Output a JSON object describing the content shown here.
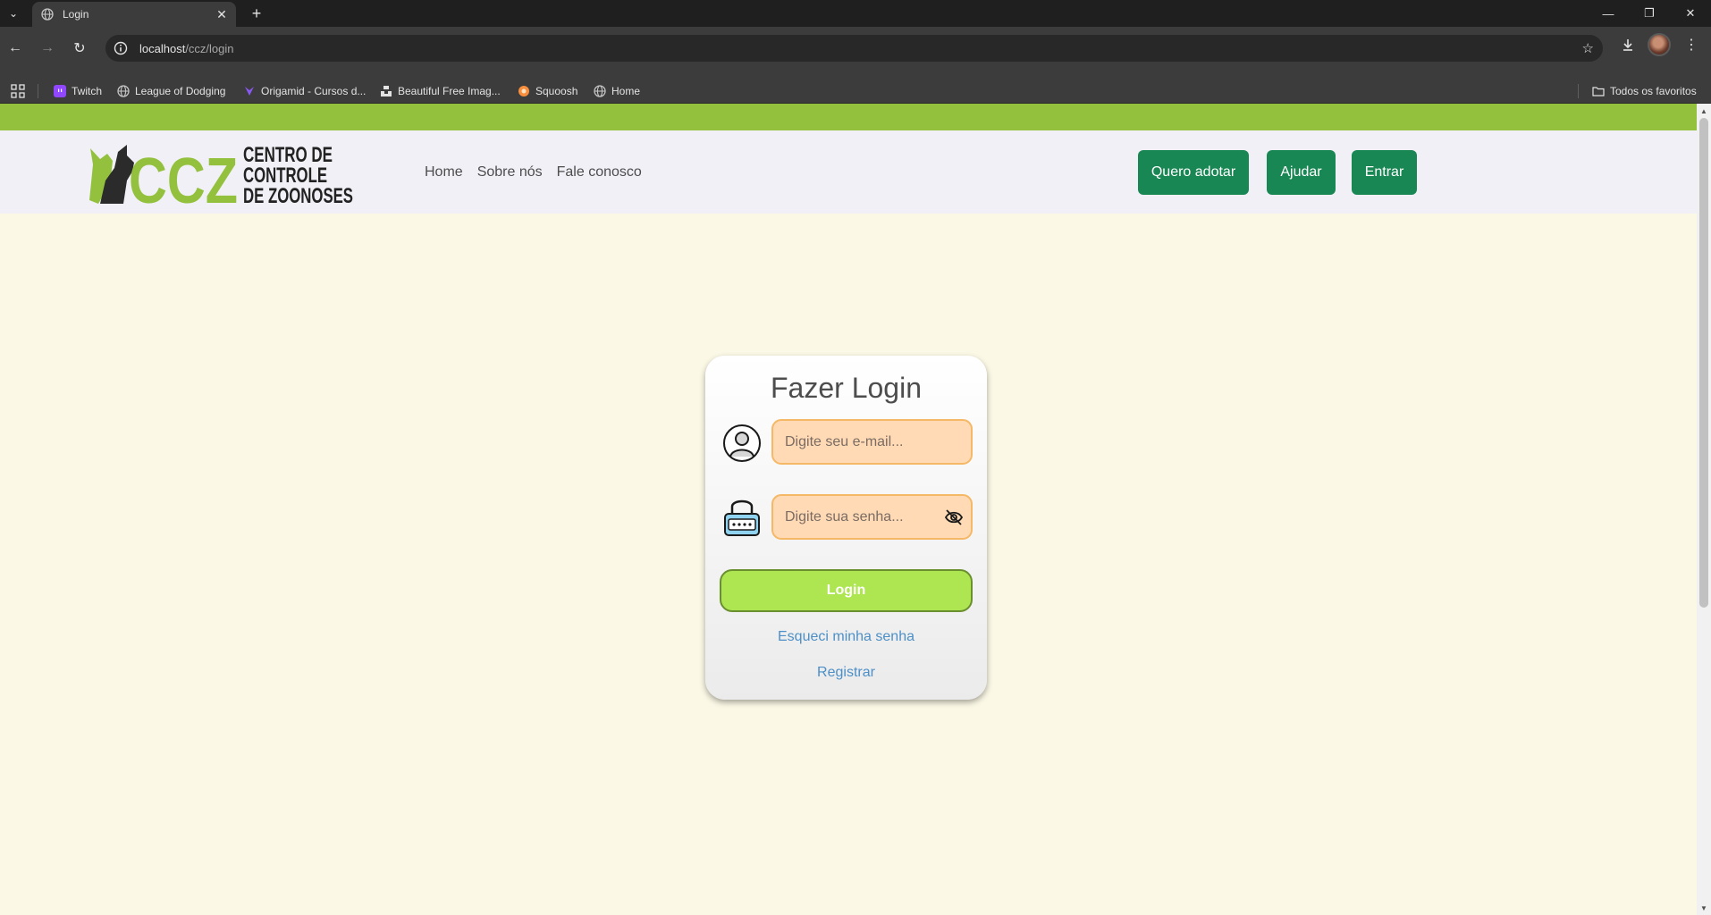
{
  "browser": {
    "tab_title": "Login",
    "url_host": "localhost",
    "url_path": "/ccz/login",
    "bookmarks": [
      {
        "label": "Twitch",
        "icon": "twitch-icon",
        "color": "#9146ff"
      },
      {
        "label": "League of Dodging",
        "icon": "globe-icon",
        "color": "#c4c4c4"
      },
      {
        "label": "Origamid - Cursos d...",
        "icon": "origamid-icon",
        "color": "#8a58f5"
      },
      {
        "label": "Beautiful Free Imag...",
        "icon": "unsplash-icon",
        "color": "#e3e3e3"
      },
      {
        "label": "Squoosh",
        "icon": "squoosh-icon",
        "color": "#f78f3f"
      },
      {
        "label": "Home",
        "icon": "globe-icon",
        "color": "#c4c4c4"
      }
    ],
    "all_bookmarks_label": "Todos os favoritos"
  },
  "header": {
    "logo_text": [
      "CENTRO DE",
      "CONTROLE",
      "DE ZOONOSES"
    ],
    "logo_mark": "CCZ",
    "nav": [
      "Home",
      "Sobre nós",
      "Fale conosco"
    ],
    "buttons": [
      "Quero adotar",
      "Ajudar",
      "Entrar"
    ]
  },
  "login": {
    "title": "Fazer Login",
    "email_placeholder": "Digite seu e-mail...",
    "password_placeholder": "Digite sua senha...",
    "submit_label": "Login",
    "forgot_label": "Esqueci minha senha",
    "register_label": "Registrar"
  },
  "colors": {
    "top_bar": "#93c13d",
    "header_button": "#198754",
    "login_button": "#aee652",
    "input_bg": "#ffdab5",
    "link": "#4d8fc6",
    "page_bg": "#fbf8e6"
  }
}
